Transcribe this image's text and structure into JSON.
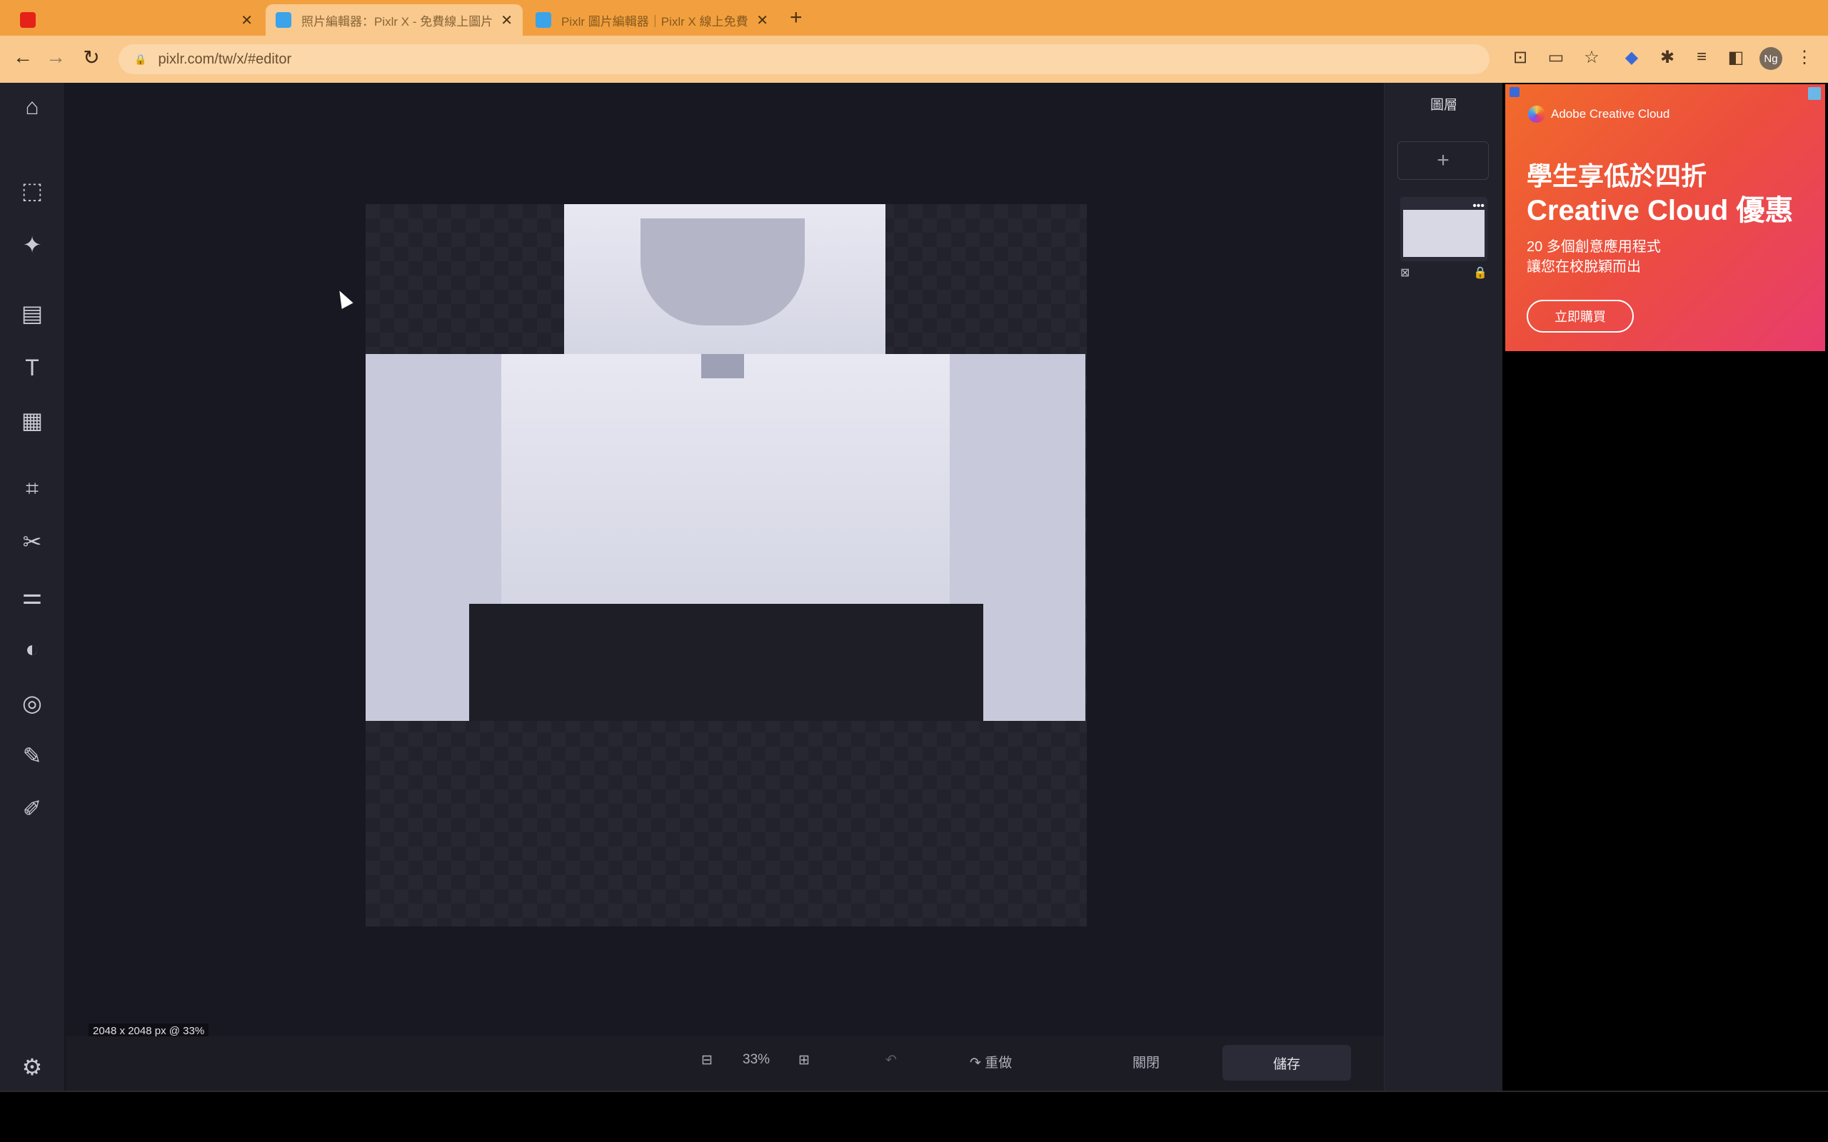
{
  "browser": {
    "tabs": [
      {
        "title": "",
        "favicon_color": "#e62117"
      },
      {
        "title": "照片編輯器：Pixlr X - 免費線上圖片",
        "favicon_color": "#3aa3ea"
      },
      {
        "title": "Pixlr 圖片編輯器｜Pixlr X 線上免費",
        "favicon_color": "#3aa3ea"
      }
    ],
    "address": "pixlr.com/tw/x/#editor",
    "profile": "Ng"
  },
  "editor": {
    "doc_info": "2048 x 2048 px @ 33%",
    "zoom": "33%",
    "redo_label": "重做",
    "close_label": "關閉",
    "save_label": "儲存",
    "layers_title": "圖層",
    "add_layer": "+"
  },
  "ad": {
    "brand": "Adobe Creative Cloud",
    "headline_1": "學生享低於四折",
    "headline_2": "Creative Cloud 優惠",
    "subline_1": "20 多個創意應用程式",
    "subline_2": "讓您在校脫穎而出",
    "cta": "立即購買"
  }
}
